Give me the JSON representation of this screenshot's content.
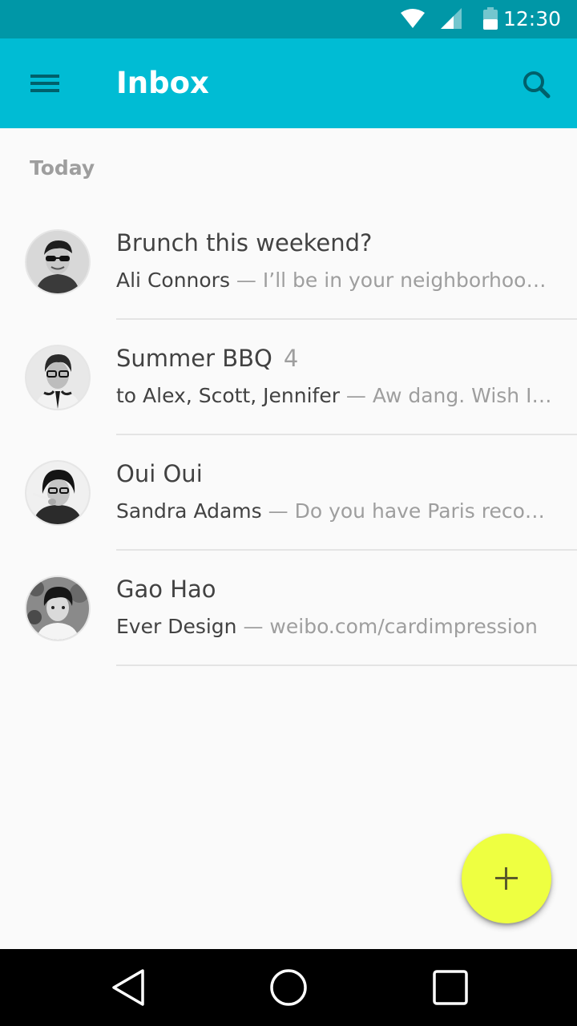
{
  "status_bar": {
    "time": "12:30",
    "icons": [
      "wifi-icon",
      "signal-icon",
      "battery-icon"
    ]
  },
  "app_bar": {
    "title": "Inbox",
    "menu_icon": "menu-icon",
    "search_icon": "search-icon",
    "color": "#00bcd4"
  },
  "section": {
    "header": "Today"
  },
  "messages": [
    {
      "title": "Brunch this weekend?",
      "count": "",
      "sender": "Ali Connors",
      "separator": " — ",
      "preview": "I’ll be in your neighborhood doing errands this weekend"
    },
    {
      "title": "Summer BBQ",
      "count": "4",
      "sender": "to Alex, Scott, Jennifer",
      "separator": " — ",
      "preview": "Aw dang. Wish I could make it"
    },
    {
      "title": "Oui Oui",
      "count": "",
      "sender": "Sandra Adams",
      "separator": " — ",
      "preview": "Do you have Paris recommendations"
    },
    {
      "title": "Gao Hao",
      "count": "",
      "sender": "Ever Design",
      "separator": " — ",
      "preview": "weibo.com/cardimpression"
    }
  ],
  "fab": {
    "icon": "plus-icon",
    "color": "#eeff41"
  },
  "nav_bar": {
    "icons": [
      "back-icon",
      "home-icon",
      "recents-icon"
    ]
  }
}
